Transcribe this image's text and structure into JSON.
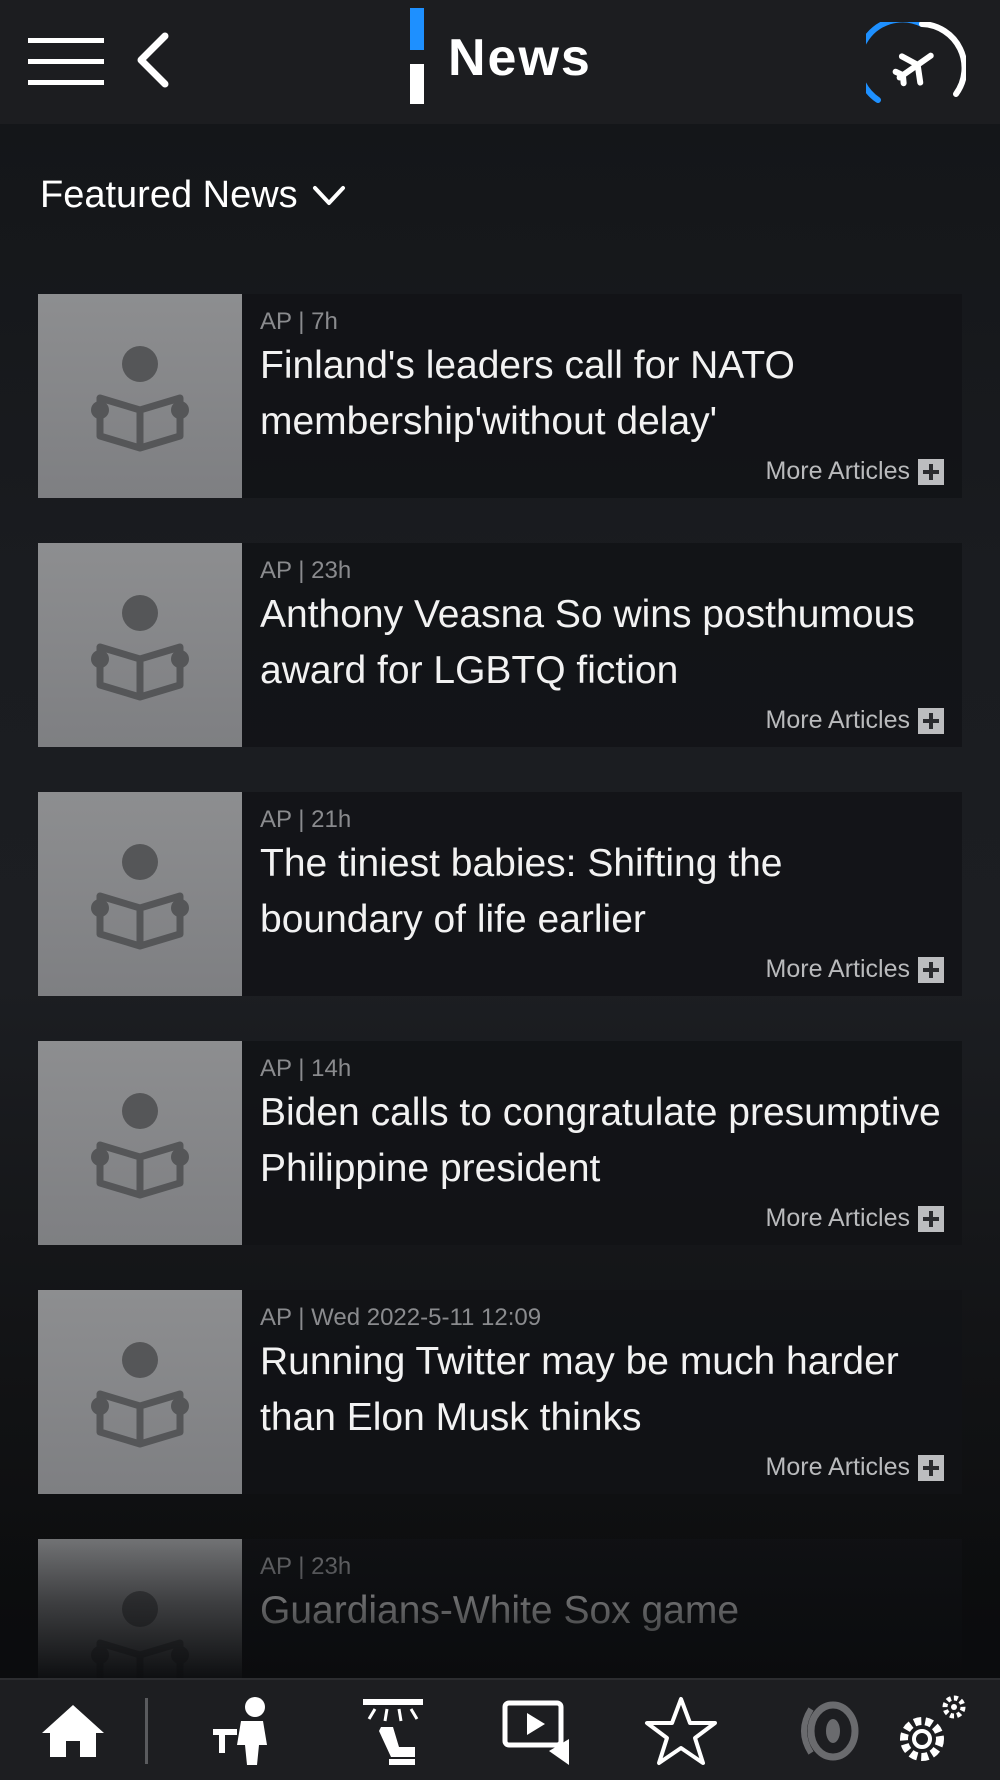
{
  "header": {
    "title": "News",
    "icons": {
      "menu": "hamburger-menu-icon",
      "back": "chevron-left-icon",
      "flight": "flight-progress-icon"
    },
    "accent_color": "#1e90ff"
  },
  "section": {
    "title": "Featured News",
    "icon": "chevron-down-icon"
  },
  "articles": [
    {
      "meta": "AP | 7h",
      "headline": "Finland's leaders call for NATO membership'without delay'",
      "more": "More Articles"
    },
    {
      "meta": "AP | 23h",
      "headline": "Anthony Veasna So wins posthumous award for LGBTQ fiction",
      "more": "More Articles"
    },
    {
      "meta": "AP | 21h",
      "headline": "The tiniest babies: Shifting the boundary of life earlier",
      "more": "More Articles"
    },
    {
      "meta": "AP | 14h",
      "headline": "Biden calls to congratulate presumptive Philippine president",
      "more": "More Articles"
    },
    {
      "meta": "AP | Wed 2022-5-11 12:09",
      "headline": "Running Twitter may be much harder than Elon Musk thinks",
      "more": "More Articles"
    },
    {
      "meta": "AP | 23h",
      "headline": "Guardians-White Sox game",
      "more": ""
    }
  ],
  "bottom_nav": [
    {
      "name": "home",
      "icon": "home-icon",
      "active": true
    },
    {
      "name": "service",
      "icon": "attendant-icon"
    },
    {
      "name": "seat",
      "icon": "seat-light-icon"
    },
    {
      "name": "media",
      "icon": "media-player-icon"
    },
    {
      "name": "favorites",
      "icon": "star-icon"
    },
    {
      "name": "audio",
      "icon": "speaker-icon"
    },
    {
      "name": "settings",
      "icon": "settings-gear-icon"
    }
  ]
}
